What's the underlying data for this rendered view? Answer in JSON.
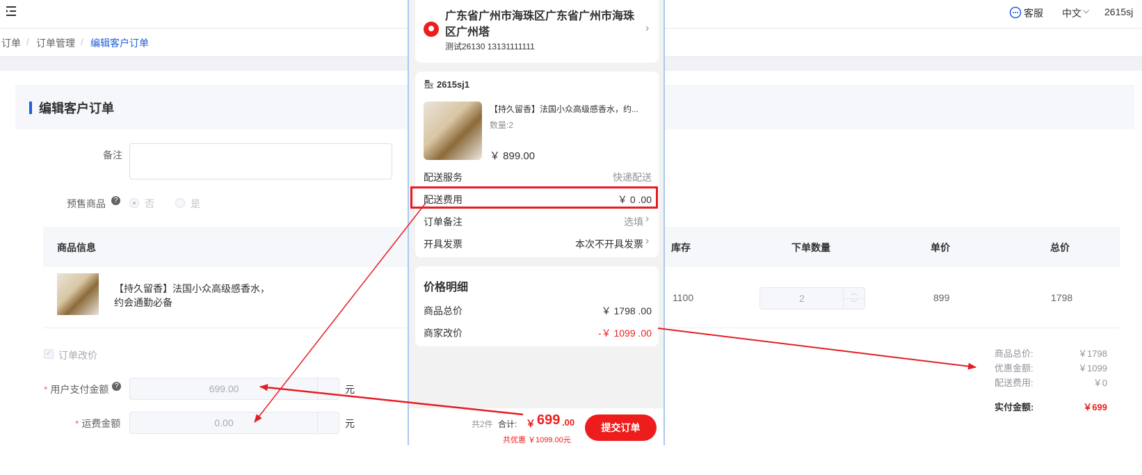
{
  "header": {
    "service_label": "客服",
    "language_label": "中文",
    "user_label": "2615sj"
  },
  "breadcrumb": [
    "订单",
    "订单管理",
    "编辑客户订单"
  ],
  "form": {
    "title": "编辑客户订单",
    "remark_label": "备注",
    "presale_label": "预售商品",
    "presale_options": [
      "否",
      "是"
    ],
    "table_headers": [
      "商品信息",
      "库存",
      "下单数量",
      "单价",
      "总价"
    ],
    "product": {
      "name_line1": "【持久留香】法国小众高级感香水，",
      "name_line2": "约会通勤必备",
      "stock": "1100",
      "quantity": "2",
      "unit_price": "899",
      "total": "1798"
    },
    "order_price_change_label": "订单改价",
    "user_pay_label": "用户支付金额",
    "user_pay_value": "699.00",
    "shipping_label": "运费金额",
    "shipping_value": "0.00",
    "unit": "元",
    "summary": {
      "goods_total_label": "商品总价:",
      "goods_total_value": "￥1798",
      "discount_label": "优惠金额:",
      "discount_value": "￥1099",
      "shipping_fee_label": "配送费用:",
      "shipping_fee_value": "￥0",
      "paid_label": "实付金额:",
      "paid_value": "￥699"
    }
  },
  "phone": {
    "address": {
      "line1": "广东省广州市海珠区广东省广州市海珠",
      "line2": "区广州塔",
      "contact": "测试26130 13131111111"
    },
    "shop_name": "2615sj1",
    "product_title": "【持久留香】法国小众高级感香水，约...",
    "quantity": "数量:2",
    "price": "￥ 899.00",
    "rows": [
      {
        "label": "配送服务",
        "value": "快递配送"
      },
      {
        "label": "配送费用",
        "value": "￥ 0 .00"
      },
      {
        "label": "订单备注",
        "value": "选填"
      },
      {
        "label": "开具发票",
        "value": "本次不开具发票"
      }
    ],
    "price_detail_title": "价格明细",
    "goods_total_label": "商品总价",
    "goods_total_value": "￥ 1798 .00",
    "merchant_change_label": "商家改价",
    "merchant_change_value": "-￥ 1099 .00",
    "footer": {
      "count": "共2件",
      "total_label": "合计:",
      "total_currency": "￥",
      "total_int": "699",
      "total_dec": ".00",
      "discount": "共优惠 ￥1099.00元",
      "submit": "提交订单"
    }
  },
  "colors": {
    "accent": "#1e5fd8",
    "red": "#ee1d1d",
    "annotation": "#e51c23"
  }
}
